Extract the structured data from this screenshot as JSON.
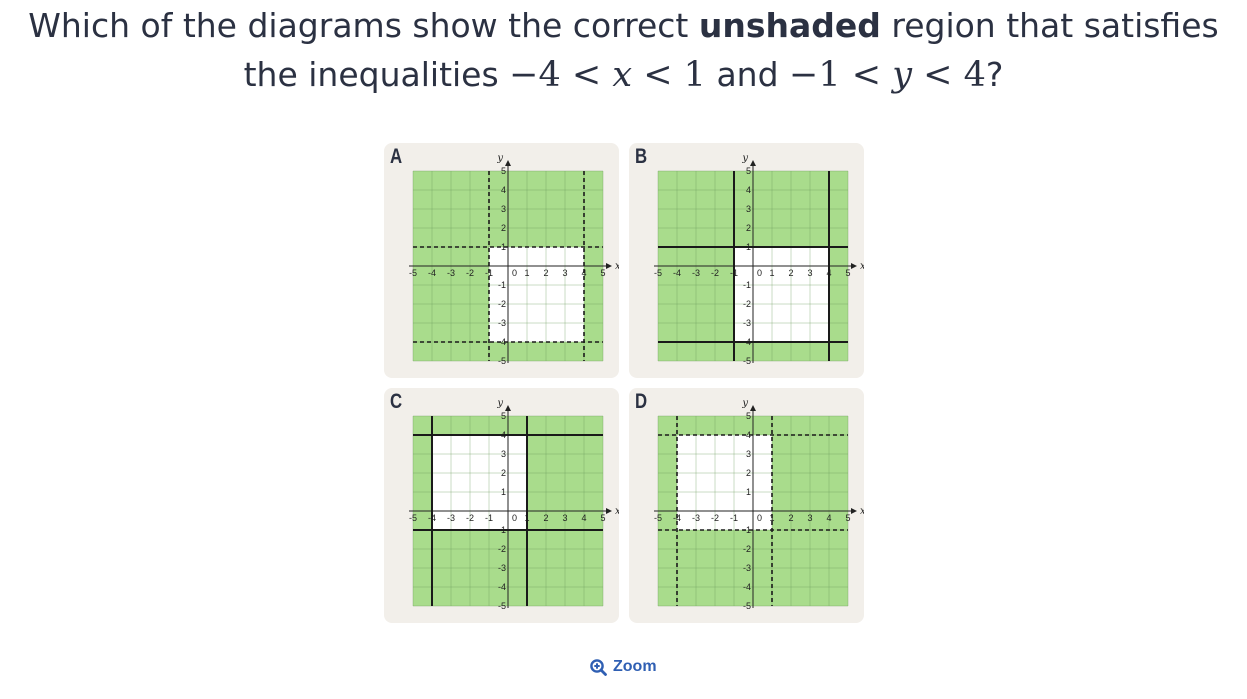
{
  "question": {
    "part1": "Which of the diagrams show the correct ",
    "bold": "unshaded",
    "part2": " region that satisfies",
    "line2_prefix": "the inequalities ",
    "ineq_x_a": "−4",
    "ineq_x_var": "x",
    "ineq_x_b": "1",
    "and": " and ",
    "ineq_y_a": "−1",
    "ineq_y_var": "y",
    "ineq_y_b": "4",
    "suffix": "?",
    "lt": " < "
  },
  "axis_labels": {
    "x": "x",
    "y": "y"
  },
  "tick_labels": [
    "-5",
    "-4",
    "-3",
    "-2",
    "-1",
    "0",
    "1",
    "2",
    "3",
    "4",
    "5"
  ],
  "colors": {
    "shade": "#a9dc8c",
    "grid": "#6a9a5a",
    "panel_bg": "#f2efea",
    "line": "#1a1a1a",
    "zoom": "#2f5fb3"
  },
  "diagrams": [
    {
      "label": "A",
      "x_bounds": [
        -1,
        4
      ],
      "y_bounds": [
        -4,
        1
      ],
      "line_style": "dashed"
    },
    {
      "label": "B",
      "x_bounds": [
        -1,
        4
      ],
      "y_bounds": [
        -4,
        1
      ],
      "line_style": "solid"
    },
    {
      "label": "C",
      "x_bounds": [
        -4,
        1
      ],
      "y_bounds": [
        -1,
        4
      ],
      "line_style": "solid"
    },
    {
      "label": "D",
      "x_bounds": [
        -4,
        1
      ],
      "y_bounds": [
        -1,
        4
      ],
      "line_style": "dashed"
    }
  ],
  "zoom": {
    "label": "Zoom",
    "icon": "zoom-in-icon"
  }
}
